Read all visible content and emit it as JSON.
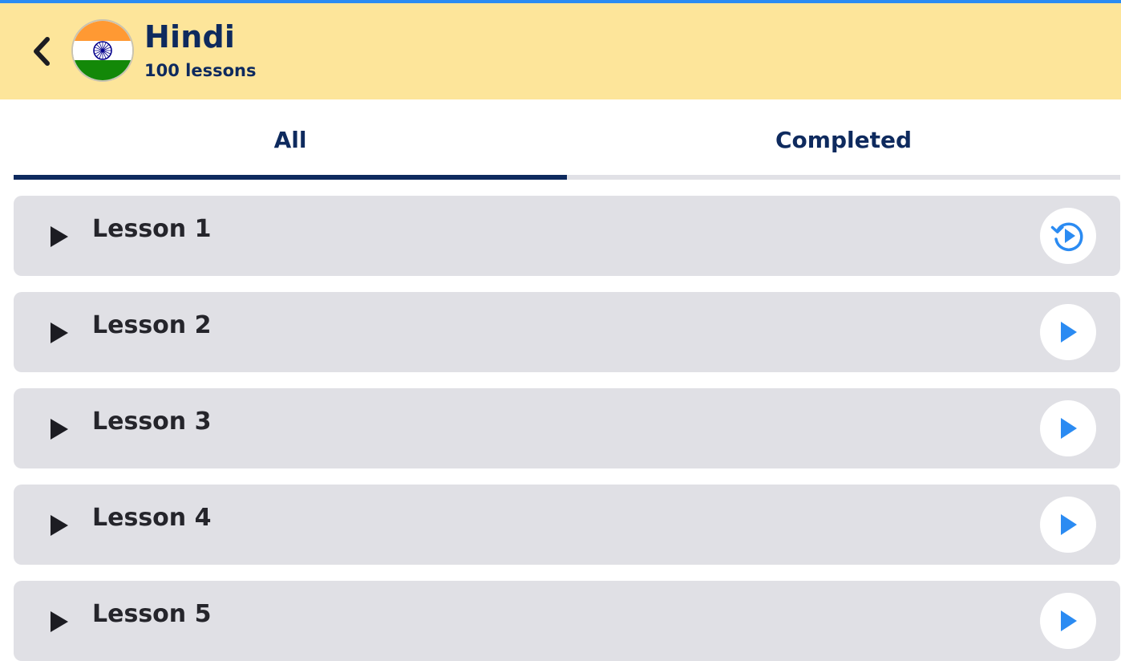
{
  "header": {
    "language": "Hindi",
    "lesson_count": "100 lessons",
    "back_icon": "chevron-left-icon",
    "flag_icon": "india-flag-icon"
  },
  "tabs": [
    {
      "label": "All",
      "selected": true
    },
    {
      "label": "Completed",
      "selected": false
    }
  ],
  "lessons": [
    {
      "label": "Lesson 1",
      "action_icon": "replay-icon"
    },
    {
      "label": "Lesson 2",
      "action_icon": "play-icon"
    },
    {
      "label": "Lesson 3",
      "action_icon": "play-icon"
    },
    {
      "label": "Lesson 4",
      "action_icon": "play-icon"
    },
    {
      "label": "Lesson 5",
      "action_icon": "play-icon"
    }
  ],
  "colors": {
    "accent": "#2b8bf2",
    "header_bg": "#fde59a",
    "navy": "#0e2a5e",
    "row_bg": "#e0e0e5"
  }
}
